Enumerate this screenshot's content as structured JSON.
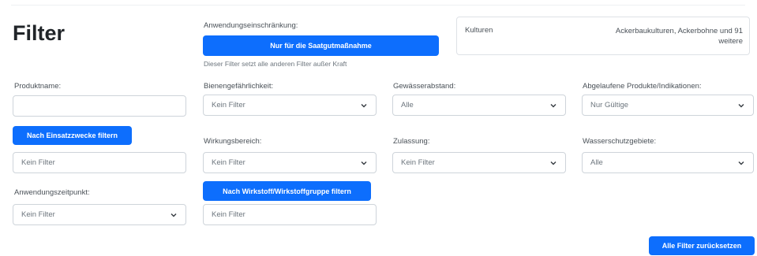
{
  "header": {
    "title": "Filter"
  },
  "anwendung": {
    "label": "Anwendungseinschränkung:",
    "button": "Nur für die Saatgutmaßnahme",
    "note": "Dieser Filter setzt alle anderen Filter außer Kraft"
  },
  "kulturen": {
    "label": "Kulturen",
    "value_line1": "Ackerbaukulturen, Ackerbohne und 91",
    "value_line2": "weitere"
  },
  "produktname": {
    "label": "Produktname:",
    "value": "",
    "placeholder": ""
  },
  "bienen": {
    "label": "Bienengefährlichkeit:",
    "selected": "Kein Filter"
  },
  "gewaesser": {
    "label": "Gewässerabstand:",
    "selected": "Alle"
  },
  "abgelaufene": {
    "label": "Abgelaufene Produkte/Indikationen:",
    "selected": "Nur Gültige"
  },
  "einsatzzwecke": {
    "button": "Nach Einsatzzwecke filtern",
    "value": "Kein Filter"
  },
  "wirkungsbereich": {
    "label": "Wirkungsbereich:",
    "selected": "Kein Filter"
  },
  "zulassung": {
    "label": "Zulassung:",
    "selected": "Kein Filter"
  },
  "wasserschutz": {
    "label": "Wasserschutzgebiete:",
    "selected": "Alle"
  },
  "anwendungszeitpunkt": {
    "label": "Anwendungszeitpunkt:",
    "selected": "Kein Filter"
  },
  "wirkstoff": {
    "button": "Nach Wirkstoff/Wirkstoffgruppe filtern",
    "value": "Kein Filter"
  },
  "reset": {
    "button": "Alle Filter zurücksetzen"
  },
  "icons": {
    "dropdown": "chevron-down-icon"
  },
  "colors": {
    "primary": "#0d6efd",
    "border": "#ced4da",
    "text": "#212529",
    "muted": "#6c757d"
  }
}
